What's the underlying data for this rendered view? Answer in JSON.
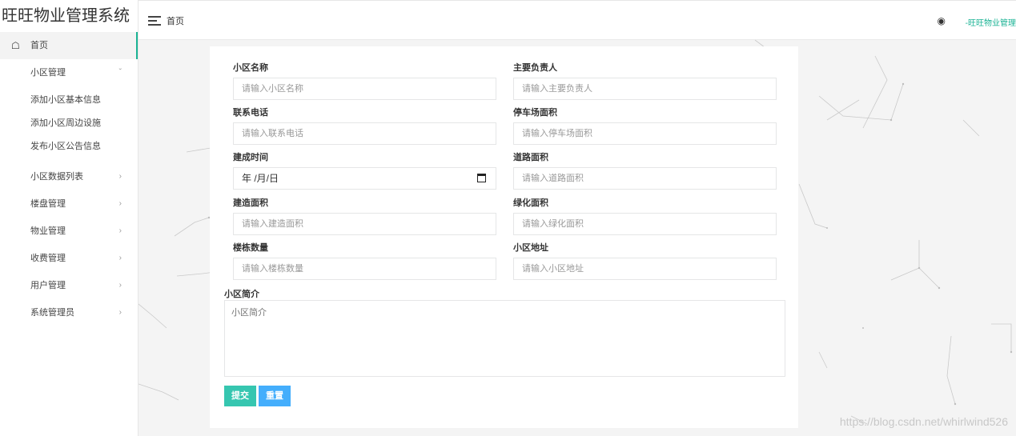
{
  "brand": "旺旺物业管理系统",
  "sidebar": {
    "home": "首页",
    "community_mgmt": "小区管理",
    "sub_items": [
      "添加小区基本信息",
      "添加小区周边设施",
      "发布小区公告信息"
    ],
    "items": [
      "小区数据列表",
      "楼盘管理",
      "物业管理",
      "收费管理",
      "用户管理",
      "系统管理员"
    ]
  },
  "header": {
    "breadcrumb": "首页",
    "user": "-旺旺物业管理"
  },
  "form": {
    "name": {
      "label": "小区名称",
      "placeholder": "请输入小区名称"
    },
    "manager": {
      "label": "主要负责人",
      "placeholder": "请输入主要负责人"
    },
    "phone": {
      "label": "联系电话",
      "placeholder": "请输入联系电话"
    },
    "parking": {
      "label": "停车场面积",
      "placeholder": "请输入停车场面积"
    },
    "built": {
      "label": "建成时间",
      "value": "年 /月/日"
    },
    "road": {
      "label": "道路面积",
      "placeholder": "请输入道路面积"
    },
    "area": {
      "label": "建造面积",
      "placeholder": "请输入建造面积"
    },
    "green": {
      "label": "绿化面积",
      "placeholder": "请输入绿化面积"
    },
    "buildings": {
      "label": "楼栋数量",
      "placeholder": "请输入楼栋数量"
    },
    "address": {
      "label": "小区地址",
      "placeholder": "请输入小区地址"
    },
    "intro": {
      "label": "小区简介",
      "placeholder": "小区简介"
    },
    "submit": "提交",
    "reset": "重置"
  },
  "watermark": "https://blog.csdn.net/whirlwind526"
}
